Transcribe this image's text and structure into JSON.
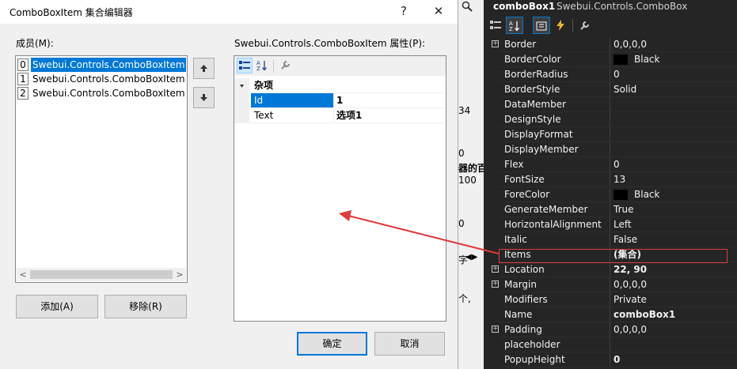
{
  "dialog": {
    "title": "ComboBoxItem 集合编辑器",
    "help_btn": "?",
    "close_btn": "✕",
    "members_label": "成员(M):",
    "members": [
      {
        "index": "0",
        "text": "Swebui.Controls.ComboBoxItem"
      },
      {
        "index": "1",
        "text": "Swebui.Controls.ComboBoxItem"
      },
      {
        "index": "2",
        "text": "Swebui.Controls.ComboBoxItem"
      }
    ],
    "props_label": "Swebui.Controls.ComboBoxItem 属性(P):",
    "category": "杂项",
    "rows": [
      {
        "name": "Id",
        "value": "1"
      },
      {
        "name": "Text",
        "value": "选项1"
      }
    ],
    "add_btn": "添加(A)",
    "remove_btn": "移除(R)",
    "ok_btn": "确定",
    "cancel_btn": "取消"
  },
  "middle": {
    "fragments": [
      "34",
      "0",
      "器的百",
      "100",
      "0",
      "字",
      "个,"
    ]
  },
  "properties": {
    "object_name": "comboBox1",
    "object_type": "Swebui.Controls.ComboBox",
    "rows": [
      {
        "name": "Border",
        "value": "0,0,0,0",
        "expand": true
      },
      {
        "name": "BorderColor",
        "value": "Black",
        "swatch": "#000000"
      },
      {
        "name": "BorderRadius",
        "value": "0"
      },
      {
        "name": "BorderStyle",
        "value": "Solid"
      },
      {
        "name": "DataMember",
        "value": ""
      },
      {
        "name": "DesignStyle",
        "value": ""
      },
      {
        "name": "DisplayFormat",
        "value": ""
      },
      {
        "name": "DisplayMember",
        "value": ""
      },
      {
        "name": "Flex",
        "value": "0"
      },
      {
        "name": "FontSize",
        "value": "13"
      },
      {
        "name": "ForeColor",
        "value": "Black",
        "swatch": "#000000"
      },
      {
        "name": "GenerateMember",
        "value": "True"
      },
      {
        "name": "HorizontalAlignment",
        "value": "Left"
      },
      {
        "name": "Italic",
        "value": "False"
      },
      {
        "name": "Items",
        "value": "(集合)",
        "bold": true
      },
      {
        "name": "Location",
        "value": "22, 90",
        "bold": true,
        "expand": true
      },
      {
        "name": "Margin",
        "value": "0,0,0,0",
        "expand": true
      },
      {
        "name": "Modifiers",
        "value": "Private"
      },
      {
        "name": "Name",
        "value": "comboBox1",
        "bold": true
      },
      {
        "name": "Padding",
        "value": "0,0,0,0",
        "expand": true
      },
      {
        "name": "placeholder",
        "value": ""
      },
      {
        "name": "PopupHeight",
        "value": "0",
        "bold": true
      }
    ]
  },
  "colors": {
    "selection": "#0078d7",
    "annotation": "#e03a3a",
    "vs_background": "#252526"
  }
}
